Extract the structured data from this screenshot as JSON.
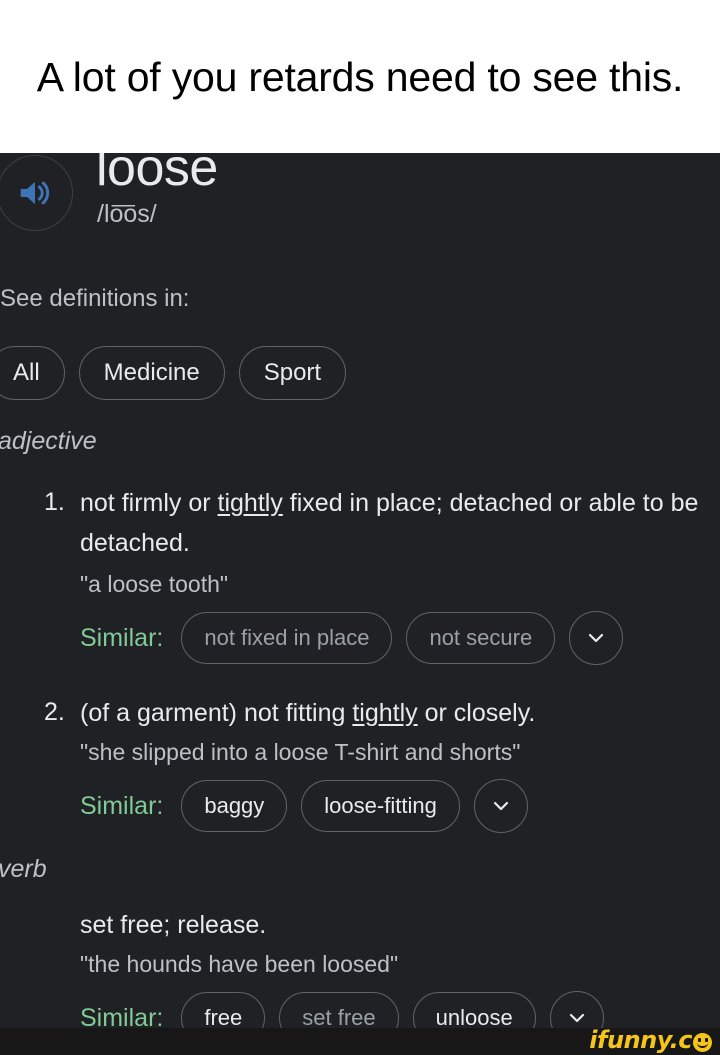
{
  "caption": {
    "text": "A lot of you retards need to see this."
  },
  "entry": {
    "word": "loose",
    "phonetic": "/lo͞os/",
    "speaker_icon": "speaker-volume-icon",
    "speaker_color": "#3d74b8"
  },
  "filters": {
    "label": "See definitions in:",
    "options": [
      "All",
      "Medicine",
      "Sport"
    ]
  },
  "similar_label": "Similar:",
  "chevron_icon": "chevron-down-icon",
  "parts_of_speech": {
    "adjective": "adjective",
    "verb": "verb"
  },
  "definitions": [
    {
      "number": "1.",
      "text_pre": "not firmly or ",
      "text_link": "tightly",
      "text_post": " fixed in place; detached or able to be detached.",
      "example": "\"a loose tooth\"",
      "similar": [
        "not fixed in place",
        "not secure"
      ]
    },
    {
      "number": "2.",
      "text_pre": "(of a garment) not fitting ",
      "text_link": "tightly",
      "text_post": " or closely.",
      "example": "\"she slipped into a loose T-shirt and shorts\"",
      "similar": [
        "baggy",
        "loose-fitting"
      ]
    },
    {
      "number": "",
      "text_pre": "set free; release.",
      "text_link": "",
      "text_post": "",
      "example": "\"the hounds have been loosed\"",
      "similar": [
        "free",
        "set free",
        "unloose"
      ]
    }
  ],
  "watermark": {
    "text": "ifunny.c",
    "color": "#f5c518"
  }
}
